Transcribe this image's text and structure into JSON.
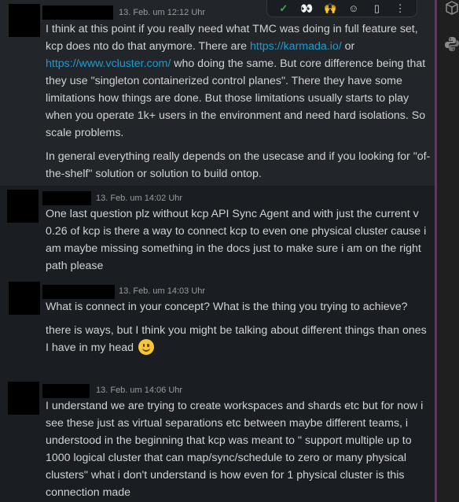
{
  "toolbar": {
    "actions": [
      {
        "name": "completed-reaction",
        "glyph": "✓"
      },
      {
        "name": "eyes-reaction",
        "glyph": "👀"
      },
      {
        "name": "raised-hands-reaction",
        "glyph": "🙌"
      },
      {
        "name": "add-reaction",
        "glyph": "☺"
      },
      {
        "name": "save-for-later",
        "glyph": "▯"
      },
      {
        "name": "more-actions",
        "glyph": "⋮"
      }
    ]
  },
  "messages": [
    {
      "timestamp": "13. Feb. um 12:12 Uhr",
      "paragraphs": [
        {
          "before_link1": "I think at this point if you really need what TMC was doing in full feature set, kcp does nto do that anymore. There are ",
          "link1": "https://karmada.io/",
          "between_links": " or ",
          "link2": "https://www.vcluster.com/",
          "after_link2": " who doing the same. But core difference being that they use \"singleton containerized control planes\". There they have some limitations how things are done. But those limitations usually starts to play when you operate 1k+ users in the environment and need hard isolations. So scale problems."
        },
        {
          "text": "In general everything really depends on the usecase and if you looking for \"of-the-shelf\" solution or solution to build ontop."
        }
      ]
    },
    {
      "timestamp": "13. Feb. um 14:02 Uhr",
      "text": "One last question plz without  kcp API Sync Agent and with just the current v 0.26 of kcp is there a way to connect kcp to even one physical cluster cause i am maybe missing something in the docs just to make sure i am on the right path please"
    },
    {
      "timestamp": "13. Feb. um 14:03 Uhr",
      "paragraph1": "What is connect in your concept? What is the thing you trying to achieve?",
      "paragraph2": "there is ways, but I think you might be talking about different things than ones I have in my head",
      "emoji": "slightly-smiling-face"
    },
    {
      "timestamp": "13. Feb. um 14:06 Uhr",
      "text": "I understand we are trying to create workspaces and shards etc but for now i see these just as virtual separations etc between maybe different teams, i understood in the beginning that kcp was meant to  \" support multiple up to 1000 logical cluster that can map/sync/schedule to zero or many physical clusters\" what i don't understand is how even for 1 physical cluster is this connection made"
    }
  ],
  "right_panel": {
    "icons": [
      "package-icon",
      "python-icon"
    ]
  },
  "colors": {
    "background": "#1a1d21",
    "hover_background": "#222529",
    "text": "#d1d2d3",
    "timestamp": "#9a9b9d",
    "link": "#1d9bd1",
    "divider": "#6b2f6e"
  }
}
